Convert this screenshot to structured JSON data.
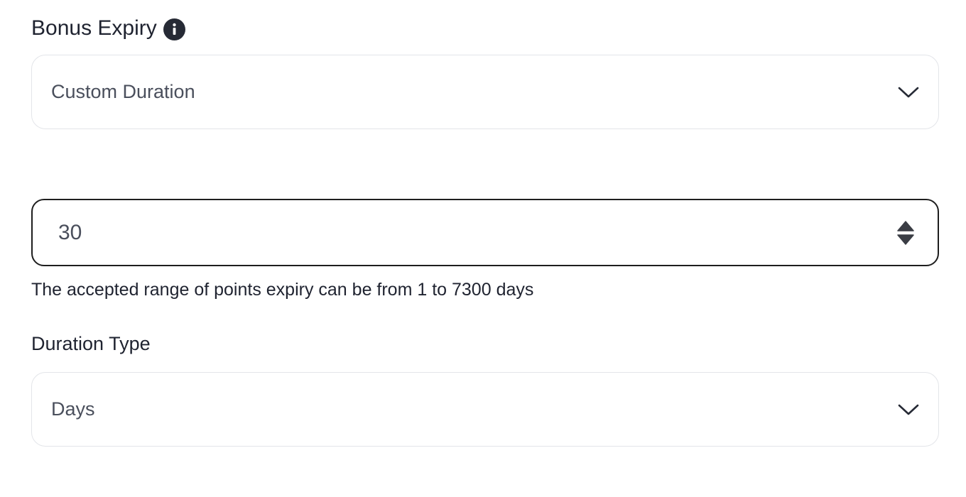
{
  "bonus_expiry": {
    "label": "Bonus Expiry",
    "info_icon": "info-circle-icon",
    "select": {
      "value": "Custom Duration",
      "icon": "chevron-down-icon"
    }
  },
  "duration_input": {
    "value": "30",
    "spinner_icon": "number-stepper-icon",
    "helper_text": "The accepted range of points expiry can be from 1 to 7300 days"
  },
  "duration_type": {
    "label": "Duration Type",
    "select": {
      "value": "Days",
      "icon": "chevron-down-icon"
    }
  },
  "colors": {
    "text_primary": "#1f2330",
    "text_value": "#4a4f5c",
    "border_light": "#e3e5e9",
    "border_focus": "#1e1e1e",
    "icon_dark": "#262a35"
  }
}
